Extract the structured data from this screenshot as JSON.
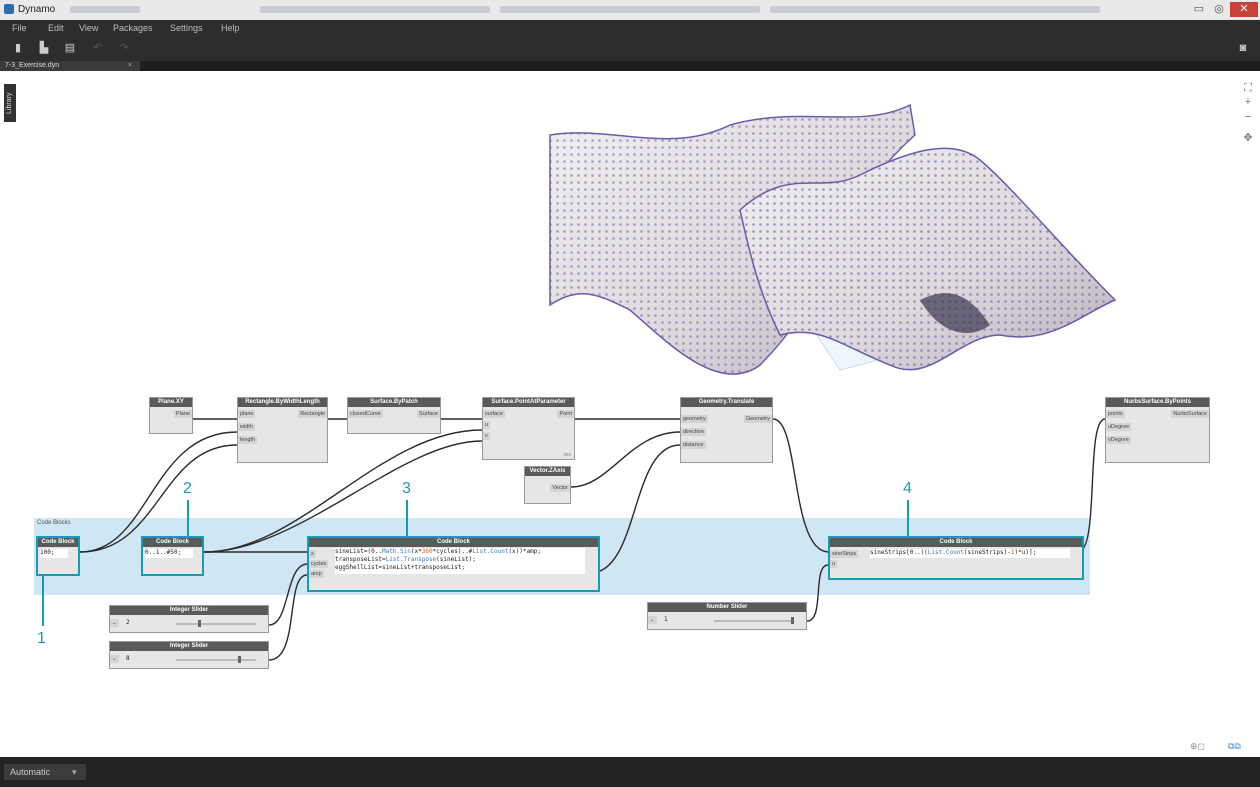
{
  "window": {
    "title": "Dynamo"
  },
  "menu": [
    "File",
    "Edit",
    "View",
    "Packages",
    "Settings",
    "Help"
  ],
  "tab": {
    "label": "7-3_Exercise.dyn",
    "close": "×"
  },
  "library": {
    "label": "Library"
  },
  "status": {
    "run_mode": "Automatic"
  },
  "group": {
    "title": "Code Blocks"
  },
  "callouts": [
    "1",
    "2",
    "3",
    "4"
  ],
  "nodes": {
    "plane_xy": {
      "title": "Plane.XY",
      "out": "Plane"
    },
    "rect": {
      "title": "Rectangle.ByWidthLength",
      "in": [
        "plane",
        "width",
        "length"
      ],
      "out": "Rectangle"
    },
    "patch": {
      "title": "Surface.ByPatch",
      "in": [
        "closedCurve"
      ],
      "out": "Surface"
    },
    "pap": {
      "title": "Surface.PointAtParameter",
      "in": [
        "surface",
        "u",
        "v"
      ],
      "out": "Point",
      "lacing": "xxx"
    },
    "zaxis": {
      "title": "Vector.ZAxis",
      "out": "Vector"
    },
    "translate": {
      "title": "Geometry.Translate",
      "in": [
        "geometry",
        "direction",
        "distance"
      ],
      "out": "Geometry"
    },
    "nurbs": {
      "title": "NurbsSurface.ByPoints",
      "in": [
        "points",
        "uDegree",
        "vDegree"
      ],
      "out": "NurbsSurface"
    },
    "cb1": {
      "title": "Code Block",
      "code": "100;"
    },
    "cb2": {
      "title": "Code Block",
      "code": "0..1..#50;"
    },
    "cb3": {
      "title": "Code Block",
      "in": [
        "x",
        "cycles",
        "amp"
      ],
      "line1": [
        "sineList=(0..",
        "Math.Sin",
        "(x*",
        "360",
        "*cycles)..#",
        "List.Count",
        "(x))*amp;"
      ],
      "line2": [
        "transposeList=",
        "List.Transpose",
        "(sineList);"
      ],
      "line3": "eggShellList=sineList+transposeList;"
    },
    "cb4": {
      "title": "Code Block",
      "in": [
        "sineStrips",
        "u"
      ],
      "code": [
        "sineStrips[0..((",
        "List.Count",
        "(sineStrips)-",
        "1",
        ")*u)];"
      ]
    },
    "islider1": {
      "title": "Integer Slider",
      "value": "2"
    },
    "islider2": {
      "title": "Integer Slider",
      "value": "8"
    },
    "nslider": {
      "title": "Number Slider",
      "value": "1"
    }
  },
  "colors": {
    "accent": "#1a9bb4",
    "group": "#cfe6f5",
    "node_header": "#5a5a5a",
    "points": "#6a5aa8"
  }
}
